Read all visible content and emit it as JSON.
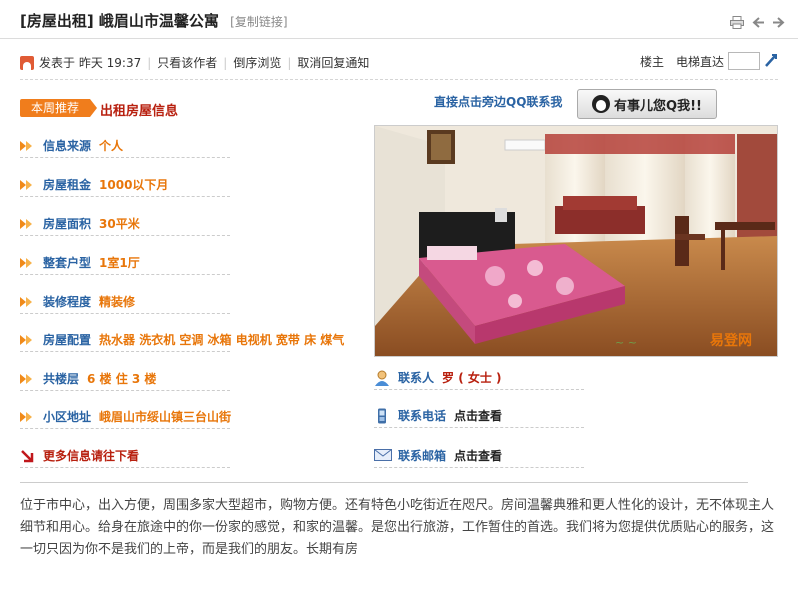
{
  "header": {
    "title": "[房屋出租] 峨眉山市温馨公寓",
    "copy_link": "[复制链接]"
  },
  "meta": {
    "posted": "发表于 昨天 19:37",
    "only_author": "只看该作者",
    "reverse": "倒序浏览",
    "cancel_notice": "取消回复通知",
    "floor": "楼主",
    "elevator": "电梯直达",
    "floor_input_value": ""
  },
  "badge": {
    "label": "本周推荐",
    "title": "出租房屋信息"
  },
  "info": [
    {
      "label": "信息来源",
      "value": "个人"
    },
    {
      "label": "房屋租金",
      "value": "1000以下月"
    },
    {
      "label": "房屋面积",
      "value": "30平米"
    },
    {
      "label": "整套户型",
      "value": "1室1厅"
    },
    {
      "label": "装修程度",
      "value": "精装修"
    },
    {
      "label": "房屋配置",
      "value": "热水器 洗衣机 空调 冰箱 电视机 宽带 床 煤气"
    },
    {
      "label": "共楼层",
      "value": "6 楼 住 3 楼"
    },
    {
      "label": "小区地址",
      "value": "峨眉山市绥山镇三台山街"
    }
  ],
  "more": "更多信息请往下看",
  "qq": {
    "text": "直接点击旁边QQ联系我",
    "button": "有事儿您Q我!!"
  },
  "contact": {
    "person_label": "联系人",
    "person_value": "罗 ( 女士 )",
    "phone_label": "联系电话",
    "phone_value": "点击查看",
    "email_label": "联系邮箱",
    "email_value": "点击查看"
  },
  "photo": {
    "watermark": "易登网"
  },
  "description": "位于市中心，出入方便，周围多家大型超市，购物方便。还有特色小吃街近在咫尺。房间温馨典雅和更人性化的设计，无不体现主人细节和用心。给身在旅途中的你一份家的感觉，和家的温馨。是您出行旅游，工作暂住的首选。我们将为您提供优质贴心的服务，这一切只因为你不是我们的上帝，而是我们的朋友。长期有房",
  "colors": {
    "accent": "#f07d1c",
    "label_blue": "#2a63a3",
    "value_orange": "#e8760a",
    "title_red": "#b8200f"
  }
}
